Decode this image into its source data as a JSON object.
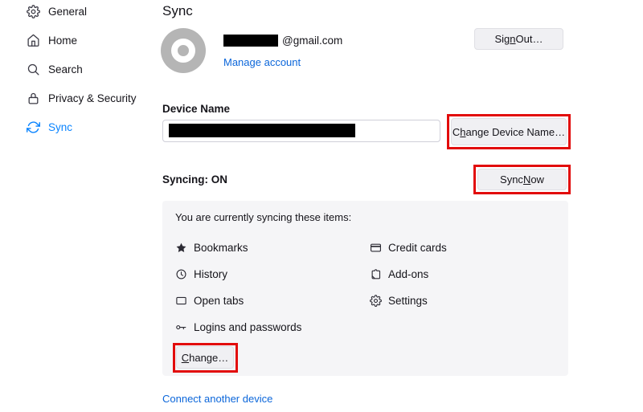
{
  "sidebar": {
    "items": [
      {
        "label": "General",
        "icon": "gear-icon",
        "active": false
      },
      {
        "label": "Home",
        "icon": "home-icon",
        "active": false
      },
      {
        "label": "Search",
        "icon": "search-icon",
        "active": false
      },
      {
        "label": "Privacy & Security",
        "icon": "lock-icon",
        "active": false
      },
      {
        "label": "Sync",
        "icon": "sync-icon",
        "active": true
      }
    ]
  },
  "header": {
    "title": "Sync",
    "account": {
      "email_redacted": true,
      "email_domain": "@gmail.com",
      "manage_link": "Manage account",
      "sign_out_button": {
        "pre": "Sig",
        "accesskey": "n",
        "post": " Out…"
      }
    }
  },
  "device_name": {
    "label": "Device Name",
    "value_redacted": true,
    "change_button": {
      "pre": "C",
      "accesskey": "h",
      "post": "ange Device Name…"
    }
  },
  "syncing": {
    "status_label": "Syncing: ON",
    "sync_now_button": {
      "pre": "Sync ",
      "accesskey": "N",
      "post": "ow"
    }
  },
  "sync_items_panel": {
    "intro": "You are currently syncing these items:",
    "items_left": [
      {
        "icon": "bookmark-star-icon",
        "label": "Bookmarks"
      },
      {
        "icon": "history-clock-icon",
        "label": "History"
      },
      {
        "icon": "open-tabs-icon",
        "label": "Open tabs"
      },
      {
        "icon": "key-icon",
        "label": "Logins and passwords"
      }
    ],
    "items_right": [
      {
        "icon": "credit-card-icon",
        "label": "Credit cards"
      },
      {
        "icon": "addons-puzzle-icon",
        "label": "Add-ons"
      },
      {
        "icon": "settings-gear-icon",
        "label": "Settings"
      }
    ],
    "change_button": {
      "pre": "",
      "accesskey": "C",
      "post": "hange…"
    }
  },
  "footer": {
    "connect_link": "Connect another device"
  },
  "colors": {
    "accent_blue": "#0a84ff",
    "link_blue": "#0b66da",
    "annotation_red": "#e20b0b",
    "panel_gray": "#f5f5f7",
    "avatar_gray": "#b5b5b5"
  }
}
